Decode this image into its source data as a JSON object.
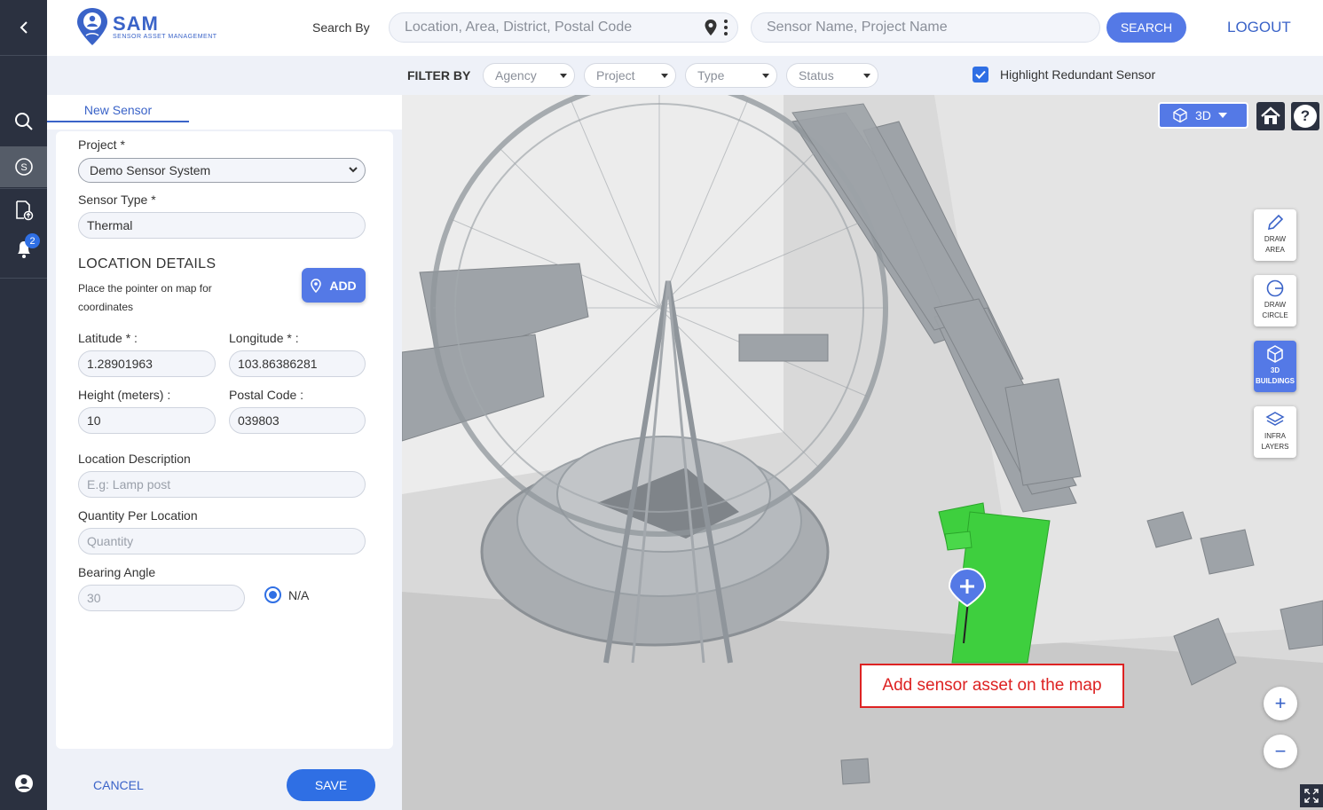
{
  "header": {
    "logo_title": "SAM",
    "logo_subtitle": "SENSOR ASSET MANAGEMENT",
    "search_by_label": "Search By",
    "location_placeholder": "Location, Area, District, Postal Code",
    "sensor_placeholder": "Sensor Name, Project Name",
    "search_button": "SEARCH",
    "logout_button": "LOGOUT"
  },
  "filter": {
    "label": "FILTER BY",
    "dropdowns": [
      "Agency",
      "Project",
      "Type",
      "Status"
    ],
    "highlight_label": "Highlight Redundant Sensor",
    "highlight_checked": true
  },
  "sidebar": {
    "notification_count": "2"
  },
  "panel": {
    "tab_label": "New Sensor",
    "project_label": "Project *",
    "project_value": "Demo Sensor System",
    "sensor_type_label": "Sensor Type *",
    "sensor_type_value": "Thermal",
    "location_title": "LOCATION DETAILS",
    "location_help": "Place the pointer on map for coordinates",
    "add_button": "ADD",
    "latitude_label": "Latitude * :",
    "latitude_value": "1.28901963",
    "longitude_label": "Longitude * :",
    "longitude_value": "103.86386281",
    "height_label": "Height (meters) :",
    "height_value": "10",
    "postal_label": "Postal Code :",
    "postal_value": "039803",
    "description_label": "Location Description",
    "description_placeholder": "E.g: Lamp post",
    "quantity_label": "Quantity Per Location",
    "quantity_placeholder": "Quantity",
    "bearing_label": "Bearing Angle",
    "bearing_placeholder": "30",
    "na_label": "N/A",
    "cancel_button": "CANCEL",
    "save_button": "SAVE"
  },
  "map": {
    "mode_label": "3D",
    "tools": [
      {
        "line1": "DRAW",
        "line2": "AREA"
      },
      {
        "line1": "DRAW",
        "line2": "CIRCLE"
      },
      {
        "line1": "3D",
        "line2": "BUILDINGS"
      },
      {
        "line1": "INFRA",
        "line2": "LAYERS"
      }
    ],
    "zoom_in": "+",
    "zoom_out": "−",
    "help_label": "?",
    "callout_text": "Add sensor asset on the map"
  },
  "colors": {
    "accent": "#5479e6",
    "rail": "#2b3140",
    "highlight_green": "#3ecf3e",
    "callout_red": "#dd2222"
  }
}
